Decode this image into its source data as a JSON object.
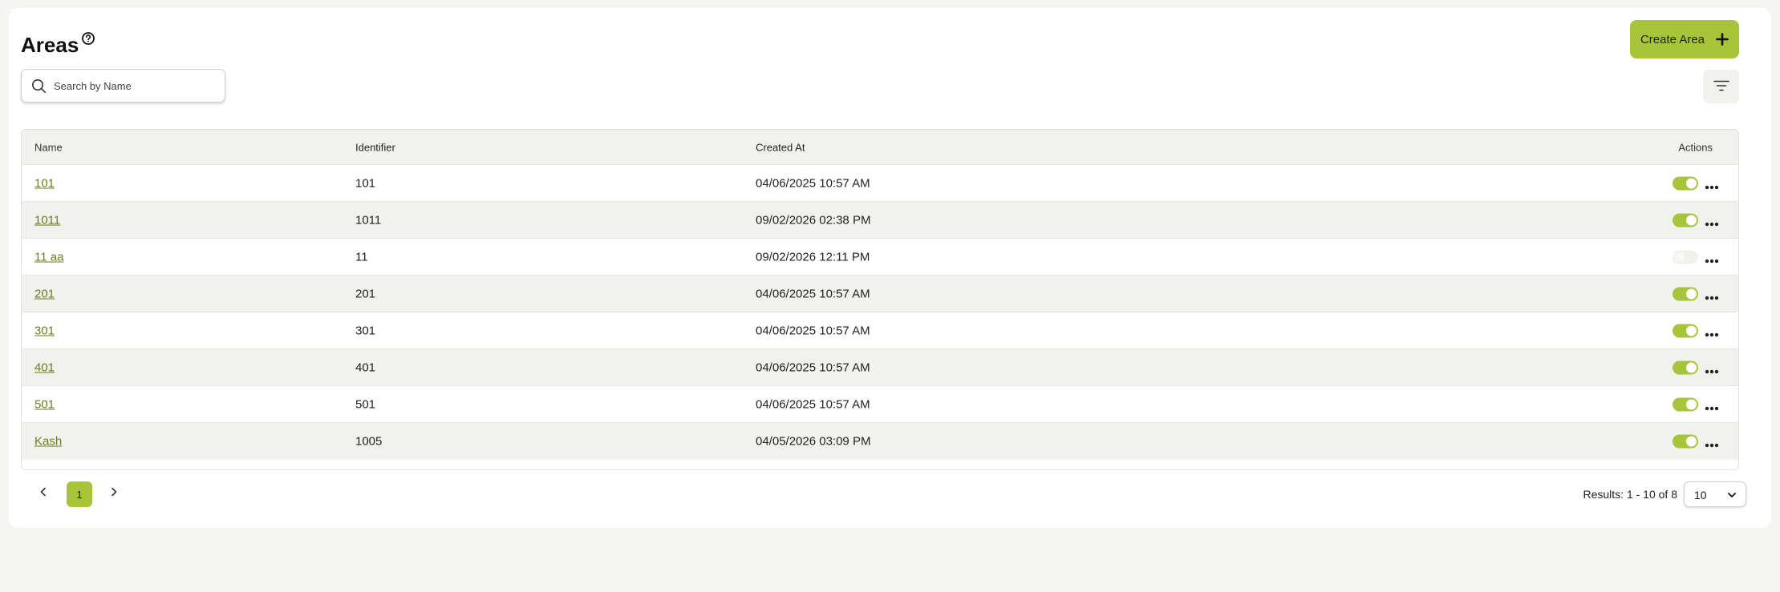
{
  "page": {
    "title": "Areas",
    "create_button_label": "Create Area"
  },
  "search": {
    "placeholder": "Search by Name",
    "value": ""
  },
  "table": {
    "columns": [
      "Name",
      "Identifier",
      "Created At",
      "Actions"
    ],
    "rows": [
      {
        "name": "101",
        "identifier": "101",
        "created_at": "04/06/2025 10:57 AM",
        "enabled": true
      },
      {
        "name": "1011",
        "identifier": "1011",
        "created_at": "09/02/2026 02:38 PM",
        "enabled": true
      },
      {
        "name": "11 aa",
        "identifier": "11",
        "created_at": "09/02/2026 12:11 PM",
        "enabled": false
      },
      {
        "name": "201",
        "identifier": "201",
        "created_at": "04/06/2025 10:57 AM",
        "enabled": true
      },
      {
        "name": "301",
        "identifier": "301",
        "created_at": "04/06/2025 10:57 AM",
        "enabled": true
      },
      {
        "name": "401",
        "identifier": "401",
        "created_at": "04/06/2025 10:57 AM",
        "enabled": true
      },
      {
        "name": "501",
        "identifier": "501",
        "created_at": "04/06/2025 10:57 AM",
        "enabled": true
      },
      {
        "name": "Kash",
        "identifier": "1005",
        "created_at": "04/05/2026 03:09 PM",
        "enabled": true
      }
    ]
  },
  "pagination": {
    "current_page": "1",
    "results_text": "Results: 1 - 10 of 8",
    "per_page": "10"
  },
  "icons": {
    "help": "help-circle-icon",
    "plus": "plus-icon",
    "search": "search-icon",
    "filter": "filter-icon",
    "more": "more-horizontal-icon",
    "prev": "chevron-left-icon",
    "next": "chevron-right-icon",
    "dropdown": "chevron-down-icon"
  },
  "colors": {
    "accent": "#a6c53a",
    "link": "#6d7d1f",
    "background": "#f5f5f2",
    "row_alt": "#f1f1ee"
  }
}
